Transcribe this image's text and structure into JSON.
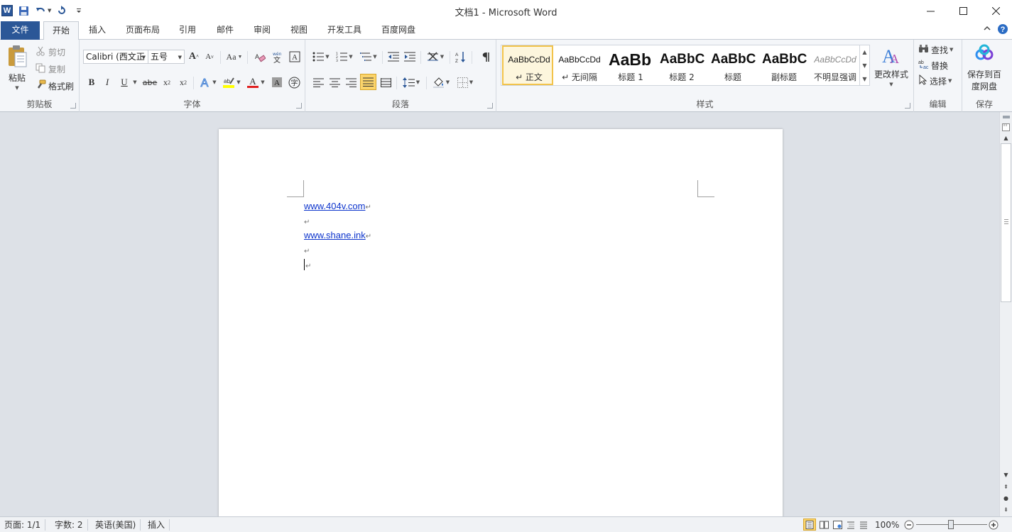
{
  "window": {
    "title": "文档1 - Microsoft Word",
    "app_icon": "word-logo",
    "logo_letter": "W"
  },
  "tabs": [
    "文件",
    "开始",
    "插入",
    "页面布局",
    "引用",
    "邮件",
    "审阅",
    "视图",
    "开发工具",
    "百度网盘"
  ],
  "clipboard": {
    "paste_label": "粘贴",
    "cut_label": "剪切",
    "copy_label": "复制",
    "format_painter_label": "格式刷",
    "group_label": "剪贴板"
  },
  "font": {
    "font_name": "Calibri (西文正",
    "font_size": "五号",
    "group_label": "字体",
    "case_label": "Aa",
    "bold": "B",
    "italic": "I",
    "underline": "U",
    "strike": "abe",
    "grow_label": "A",
    "shrink_label": "A",
    "font_color": "#e02020",
    "highlight_color": "#ffff00"
  },
  "paragraph": {
    "group_label": "段落"
  },
  "styles": {
    "group_label": "样式",
    "items": [
      {
        "sample": "AaBbCcDd",
        "name": "↵ 正文"
      },
      {
        "sample": "AaBbCcDd",
        "name": "↵ 无间隔"
      },
      {
        "sample": "AaBb",
        "name": "标题 1"
      },
      {
        "sample": "AaBbC",
        "name": "标题 2"
      },
      {
        "sample": "AaBbC",
        "name": "标题"
      },
      {
        "sample": "AaBbC",
        "name": "副标题"
      },
      {
        "sample": "AaBbCcDd",
        "name": "不明显强调"
      }
    ],
    "change_styles_label": "更改样式"
  },
  "editing": {
    "group_label": "编辑",
    "find_label": "查找",
    "replace_label": "替换",
    "select_label": "选择"
  },
  "save": {
    "group_label": "保存",
    "save_baidu_line1": "保存到百",
    "save_baidu_line2": "度网盘"
  },
  "document": {
    "paragraphs": [
      {
        "text": "www.404v.com",
        "link": true
      },
      {
        "text": "",
        "link": false
      },
      {
        "text": "www.shane.ink",
        "link": true
      },
      {
        "text": "",
        "link": false
      },
      {
        "text": "",
        "link": false,
        "cursor": true
      }
    ],
    "paragraph_mark": "↵",
    "link_color": "#0b33cc"
  },
  "status": {
    "page": "页面: 1/1",
    "words": "字数: 2",
    "language": "英语(美国)",
    "mode": "插入",
    "zoom": "100%",
    "zoom_level": 1.0
  }
}
